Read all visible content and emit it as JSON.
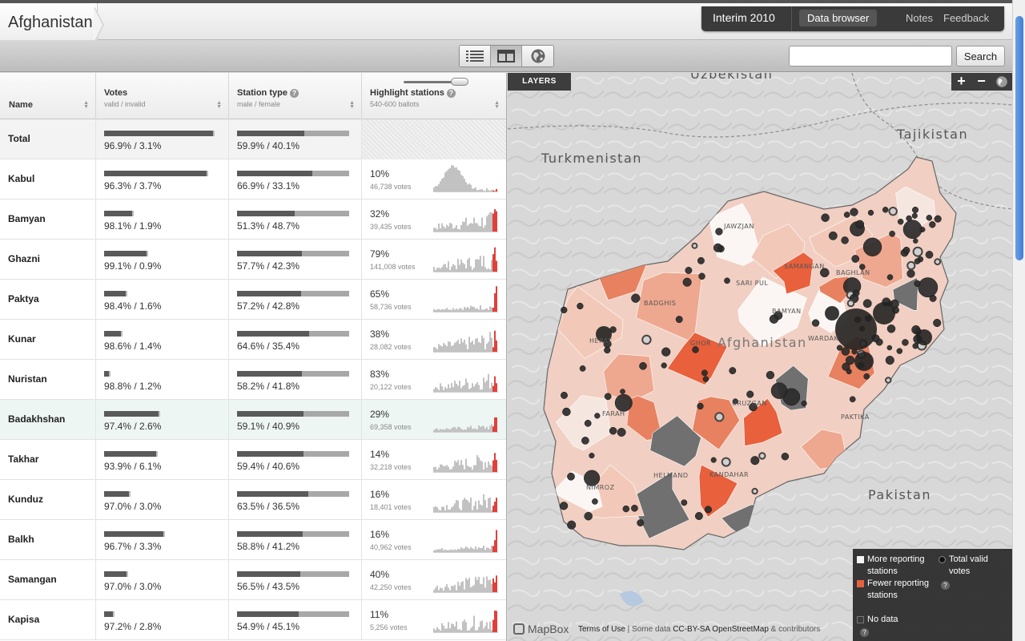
{
  "header": {
    "breadcrumb": "Afghanistan"
  },
  "nav": {
    "title": "Interim 2010",
    "items": [
      {
        "label": "Data browser",
        "active": true
      },
      {
        "label": "Notes"
      },
      {
        "label": "Feedback"
      }
    ]
  },
  "toolbar": {
    "search_placeholder": "",
    "search_label": "Search"
  },
  "table": {
    "columns": {
      "name": "Name",
      "votes": {
        "title": "Votes",
        "sub": "valid / invalid"
      },
      "station": {
        "title": "Station type",
        "sub": "male / female"
      },
      "highlight": {
        "title": "Highlight stations",
        "sub": "540-600 ballots"
      }
    },
    "total": {
      "name": "Total",
      "votes": "96.9% / 3.1%",
      "station": "59.9% / 40.1%",
      "votes_frac": 0.969,
      "station_frac": 0.599
    },
    "rows": [
      {
        "name": "Kabul",
        "votes": "96.3% / 3.7%",
        "station": "66.9% / 33.1%",
        "pct": "10%",
        "count": "46,738 votes",
        "votes_frac": 0.963,
        "station_frac": 0.669,
        "volume": 0.95
      },
      {
        "name": "Bamyan",
        "votes": "98.1% / 1.9%",
        "station": "51.3% / 48.7%",
        "pct": "32%",
        "count": "39,435 votes",
        "votes_frac": 0.981,
        "station_frac": 0.513,
        "volume": 0.26
      },
      {
        "name": "Ghazni",
        "votes": "99.1% / 0.9%",
        "station": "57.7% / 42.3%",
        "pct": "79%",
        "count": "141,008 votes",
        "votes_frac": 0.991,
        "station_frac": 0.577,
        "volume": 0.38
      },
      {
        "name": "Paktya",
        "votes": "98.4% / 1.6%",
        "station": "57.2% / 42.8%",
        "pct": "65%",
        "count": "58,736 votes",
        "votes_frac": 0.984,
        "station_frac": 0.572,
        "volume": 0.19
      },
      {
        "name": "Kunar",
        "votes": "98.6% / 1.4%",
        "station": "64.6% / 35.4%",
        "pct": "38%",
        "count": "28,082 votes",
        "votes_frac": 0.986,
        "station_frac": 0.646,
        "volume": 0.15
      },
      {
        "name": "Nuristan",
        "votes": "98.8% / 1.2%",
        "station": "58.2% / 41.8%",
        "pct": "83%",
        "count": "20,122 votes",
        "votes_frac": 0.988,
        "station_frac": 0.582,
        "volume": 0.04
      },
      {
        "name": "Badakhshan",
        "votes": "97.4% / 2.6%",
        "station": "59.1% / 40.9%",
        "pct": "29%",
        "count": "69,358 votes",
        "votes_frac": 0.974,
        "station_frac": 0.591,
        "volume": 0.5,
        "highlight": true
      },
      {
        "name": "Takhar",
        "votes": "93.9% / 6.1%",
        "station": "59.4% / 40.6%",
        "pct": "14%",
        "count": "32,218 votes",
        "votes_frac": 0.939,
        "station_frac": 0.594,
        "volume": 0.49
      },
      {
        "name": "Kunduz",
        "votes": "97.0% / 3.0%",
        "station": "63.5% / 36.5%",
        "pct": "16%",
        "count": "18,401 votes",
        "votes_frac": 0.97,
        "station_frac": 0.635,
        "volume": 0.23
      },
      {
        "name": "Balkh",
        "votes": "96.7% / 3.3%",
        "station": "58.8% / 41.2%",
        "pct": "16%",
        "count": "40,962 votes",
        "votes_frac": 0.967,
        "station_frac": 0.588,
        "volume": 0.55
      },
      {
        "name": "Samangan",
        "votes": "97.0% / 3.0%",
        "station": "56.5% / 43.5%",
        "pct": "40%",
        "count": "42,250 votes",
        "votes_frac": 0.97,
        "station_frac": 0.565,
        "volume": 0.21
      },
      {
        "name": "Kapisa",
        "votes": "97.2% / 2.8%",
        "station": "54.9% / 45.1%",
        "pct": "11%",
        "count": "5,256 votes",
        "votes_frac": 0.972,
        "station_frac": 0.549,
        "volume": 0.08
      }
    ]
  },
  "map": {
    "layers_label": "LAYERS",
    "countries": [
      "Uzbekistan",
      "Tajikistan",
      "Turkmenistan",
      "Pakistan",
      "Afghanistan"
    ],
    "provinces": [
      "JAWZJAN",
      "SAMANGAN",
      "BAGHLAN",
      "SARI PUL",
      "BADGHIS",
      "BAMYAN",
      "WARDAK",
      "HERAT",
      "GHOR",
      "PAKTIKA",
      "URUZGAN",
      "FARAH",
      "KANDAHAR",
      "HELMAND",
      "NIMROZ"
    ],
    "legend": {
      "more": "More reporting stations",
      "fewer": "Fewer reporting stations",
      "nodata": "No data",
      "total": "Total valid votes"
    },
    "attribution": {
      "logo": "MapBox",
      "terms": "Terms of Use",
      "text1": " | Some data ",
      "license": "CC-BY-SA OpenStreetMap",
      "text2": " & contributors"
    }
  },
  "colors": {
    "accent_orange": "#e8603c",
    "nodata": "#6d6d6d",
    "dot": "#2b2b2b",
    "nav_bg": "#3a3a3a"
  }
}
